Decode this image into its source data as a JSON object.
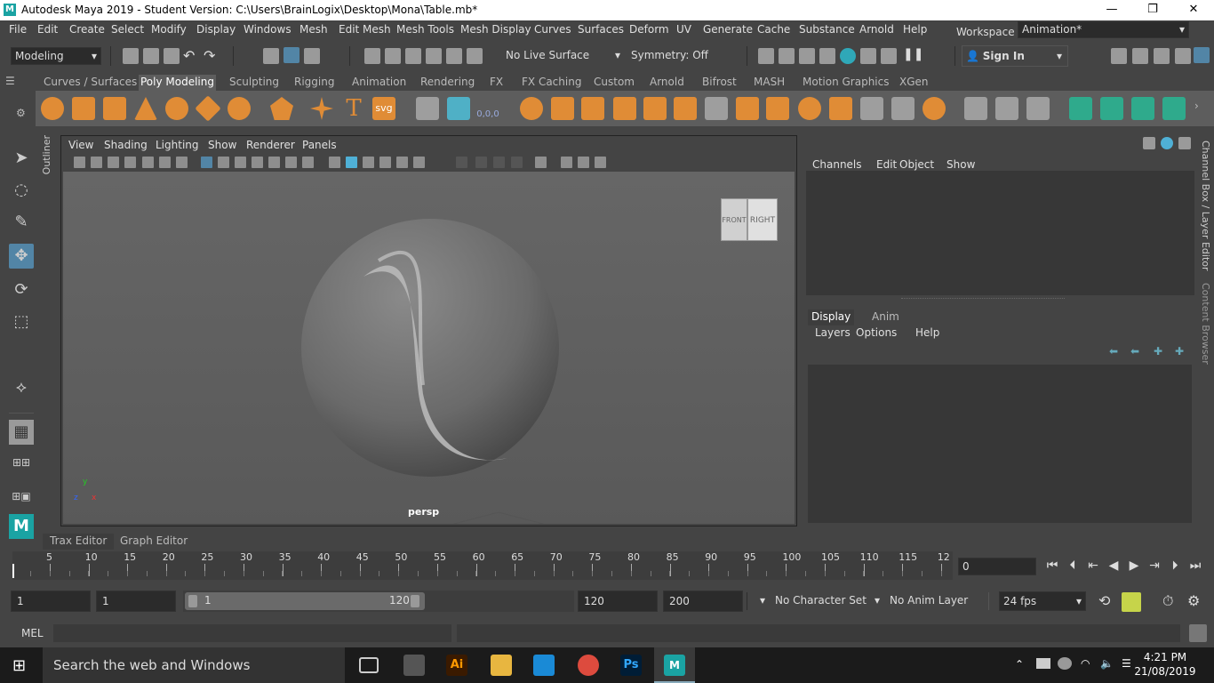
{
  "window": {
    "title": "Autodesk Maya 2019 - Student Version: C:\\Users\\BrainLogix\\Desktop\\Mona\\Table.mb*",
    "minimize_glyph": "—",
    "restore_glyph": "❐",
    "close_glyph": "✕"
  },
  "menubar": {
    "items": [
      "File",
      "Edit",
      "Create",
      "Select",
      "Modify",
      "Display",
      "Windows",
      "Mesh",
      "Edit Mesh",
      "Mesh Tools",
      "Mesh Display",
      "Curves",
      "Surfaces",
      "Deform",
      "UV",
      "Generate",
      "Cache",
      "Substance",
      "Arnold",
      "Help"
    ],
    "workspace_label": "Workspace :",
    "workspace_value": "Animation*"
  },
  "statusline": {
    "menuset": "Modeling",
    "live_surface": "No Live Surface",
    "symmetry": "Symmetry: Off",
    "sign_in": "Sign In"
  },
  "shelf": {
    "tabs": [
      "Curves / Surfaces",
      "Poly Modeling",
      "Sculpting",
      "Rigging",
      "Animation",
      "Rendering",
      "FX",
      "FX Caching",
      "Custom",
      "Arnold",
      "Bifrost",
      "MASH",
      "Motion Graphics",
      "XGen"
    ],
    "active_tab": "Poly Modeling",
    "text_icons": {
      "type": "T",
      "svg": "svg",
      "snowflake": "0,0,0"
    }
  },
  "viewport": {
    "menus": [
      "View",
      "Shading",
      "Lighting",
      "Show",
      "Renderer",
      "Panels"
    ],
    "camera_label": "persp",
    "viewcube": {
      "front": "FRONT",
      "right": "RIGHT"
    },
    "axis": {
      "x": "x",
      "y": "y",
      "z": "z"
    }
  },
  "outliner_tab": "Outliner",
  "channelbox": {
    "menus": [
      "Channels",
      "Edit",
      "Object",
      "Show"
    ],
    "layer_tabs": [
      "Display",
      "Anim"
    ],
    "active_layer_tab": "Display",
    "layer_menus": [
      "Layers",
      "Options",
      "Help"
    ]
  },
  "side_tabs": {
    "channel_box": "Channel Box / Layer Editor",
    "content_browser": "Content Browser"
  },
  "editor_tabs": [
    "Trax Editor",
    "Graph Editor"
  ],
  "timeslider": {
    "labels": [
      "5",
      "10",
      "15",
      "20",
      "25",
      "30",
      "35",
      "40",
      "45",
      "50",
      "55",
      "60",
      "65",
      "70",
      "75",
      "80",
      "85",
      "90",
      "95",
      "100",
      "105",
      "110",
      "115",
      "12"
    ],
    "current_frame": "0"
  },
  "range": {
    "start": "1",
    "playback_start": "1",
    "slider_start": "1",
    "slider_end": "120",
    "playback_end": "120",
    "end": "200",
    "character_set": "No Character Set",
    "anim_layer": "No Anim Layer",
    "fps": "24 fps"
  },
  "cmdline": {
    "label": "MEL"
  },
  "taskbar": {
    "search_placeholder": "Search the web and Windows",
    "ai_label": "Ai",
    "ps_label": "Ps",
    "maya_label": "M",
    "time": "4:21 PM",
    "date": "21/08/2019"
  },
  "colors": {
    "accent": "#5285a6",
    "shelf_orange": "#e08c36",
    "maya_teal": "#1aa3a3"
  }
}
